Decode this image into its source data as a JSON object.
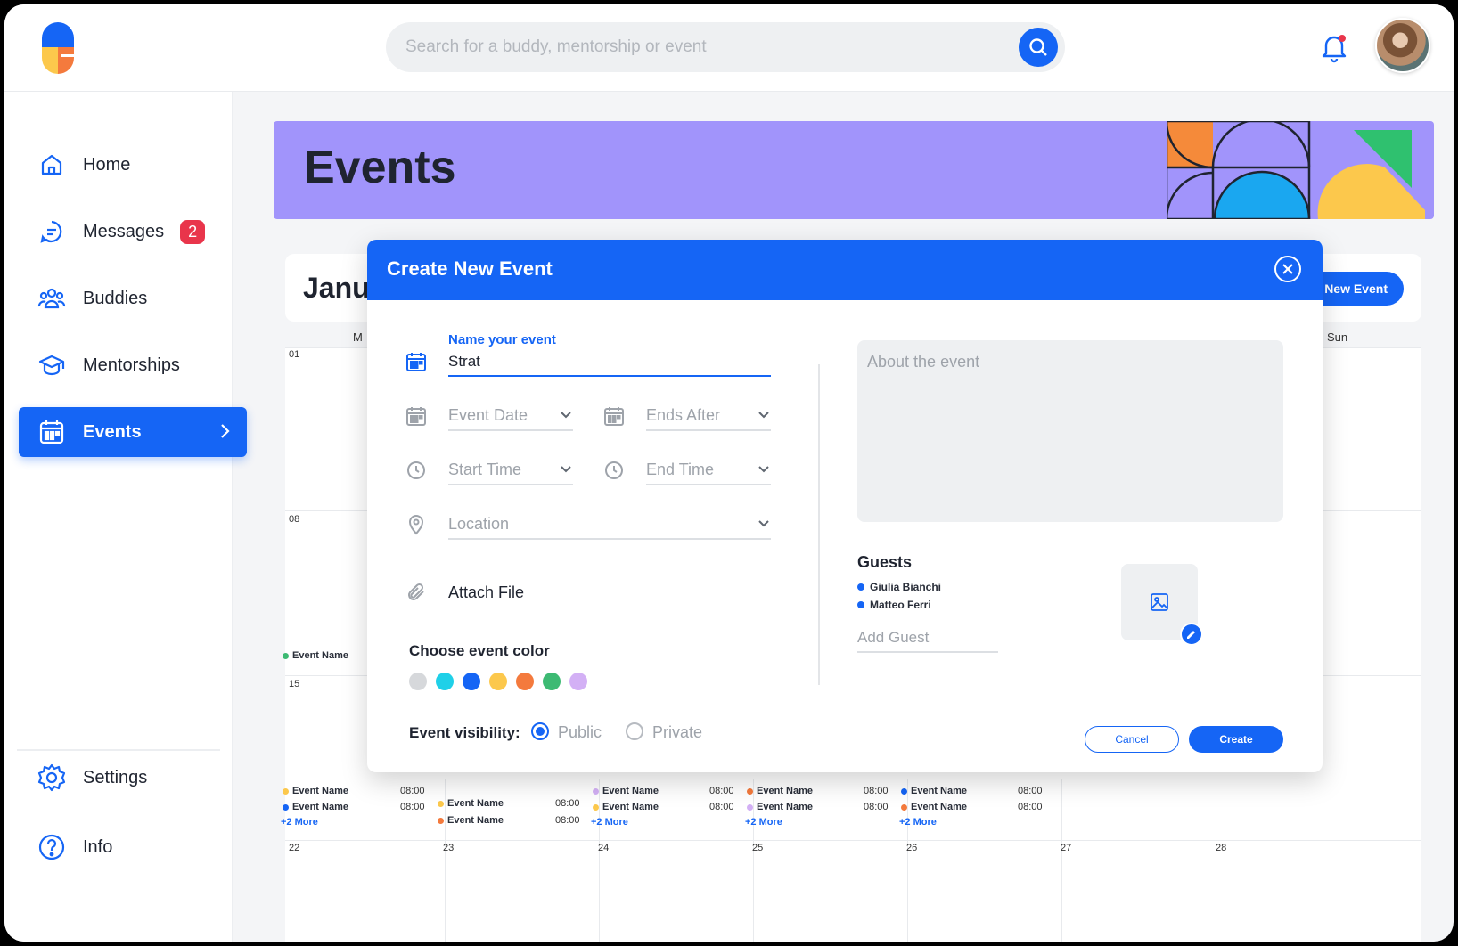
{
  "search": {
    "placeholder": "Search for a buddy, mentorship or event"
  },
  "sidebar": {
    "items": [
      {
        "label": "Home"
      },
      {
        "label": "Messages",
        "badge": "2"
      },
      {
        "label": "Buddies"
      },
      {
        "label": "Mentorships"
      },
      {
        "label": "Events"
      },
      {
        "label": "Settings"
      },
      {
        "label": "Info"
      }
    ]
  },
  "banner": {
    "title": "Events"
  },
  "calendar": {
    "month": "Janu",
    "new_event_label": "New Event",
    "days": {
      "mon": "M",
      "sun": "Sun"
    },
    "week_start_numbers": [
      "01",
      "08",
      "15"
    ],
    "week4": [
      "22",
      "23",
      "24",
      "25",
      "26",
      "27",
      "28"
    ],
    "event_label": "Event Name",
    "time": "08:00",
    "more": "+2 More"
  },
  "modal": {
    "title": "Create New Event",
    "name_label": "Name your event",
    "name_value": "Strat",
    "event_date": "Event Date",
    "ends_after": "Ends After",
    "start_time": "Start Time",
    "end_time": "End Time",
    "location": "Location",
    "attach": "Attach File",
    "color_title": "Choose event color",
    "colors": [
      "#d6d8db",
      "#1fd0e8",
      "#1565f5",
      "#fcc84c",
      "#f47a3d",
      "#3dba73",
      "#d3b0f5"
    ],
    "visibility_label": "Event visibility:",
    "public": "Public",
    "private": "Private",
    "about_placeholder": "About the event",
    "guests_title": "Guests",
    "guests": [
      "Giulia Bianchi",
      "Matteo Ferri"
    ],
    "add_guest_placeholder": "Add Guest",
    "cancel": "Cancel",
    "create": "Create"
  },
  "icons": {
    "accent": "#1565f5",
    "names": [
      "logo",
      "search-icon",
      "bell-icon",
      "home-icon",
      "message-icon",
      "buddies-icon",
      "mortarboard-icon",
      "calendar-icon",
      "gear-icon",
      "help-icon",
      "close-icon",
      "clock-icon",
      "pin-icon",
      "paperclip-icon",
      "image-icon",
      "pencil-icon",
      "chevron-down-icon"
    ]
  }
}
